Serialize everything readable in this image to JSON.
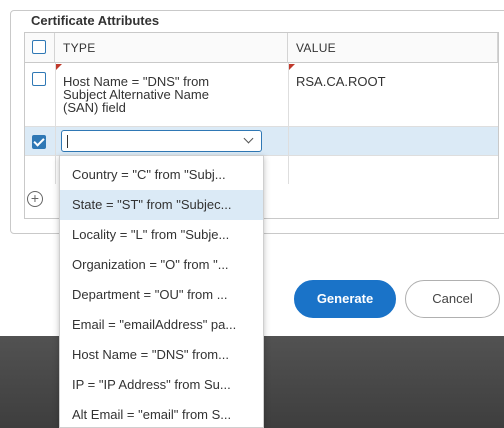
{
  "fieldset": {
    "legend": "Certificate Attributes"
  },
  "table": {
    "columns": [
      "TYPE",
      "VALUE"
    ],
    "rows": [
      {
        "type_lines": [
          "Host Name = \"DNS\" from",
          "Subject Alternative Name",
          "(SAN) field"
        ],
        "value": "RSA.CA.ROOT",
        "checked": false
      },
      {
        "type": "",
        "value": "",
        "checked": true,
        "editing": true
      }
    ],
    "add_icon": "plus-circle-icon"
  },
  "dropdown": {
    "options": [
      "Country = \"C\" from \"Subj...",
      "State = \"ST\" from \"Subjec...",
      "Locality = \"L\" from \"Subje...",
      "Organization = \"O\" from \"...",
      "Department = \"OU\" from ...",
      "Email = \"emailAddress\" pa...",
      "Host Name = \"DNS\" from...",
      "IP = \"IP Address\" from Su...",
      "Alt Email = \"email\" from S..."
    ],
    "highlighted_index": 1
  },
  "buttons": {
    "generate": "Generate",
    "cancel": "Cancel"
  }
}
